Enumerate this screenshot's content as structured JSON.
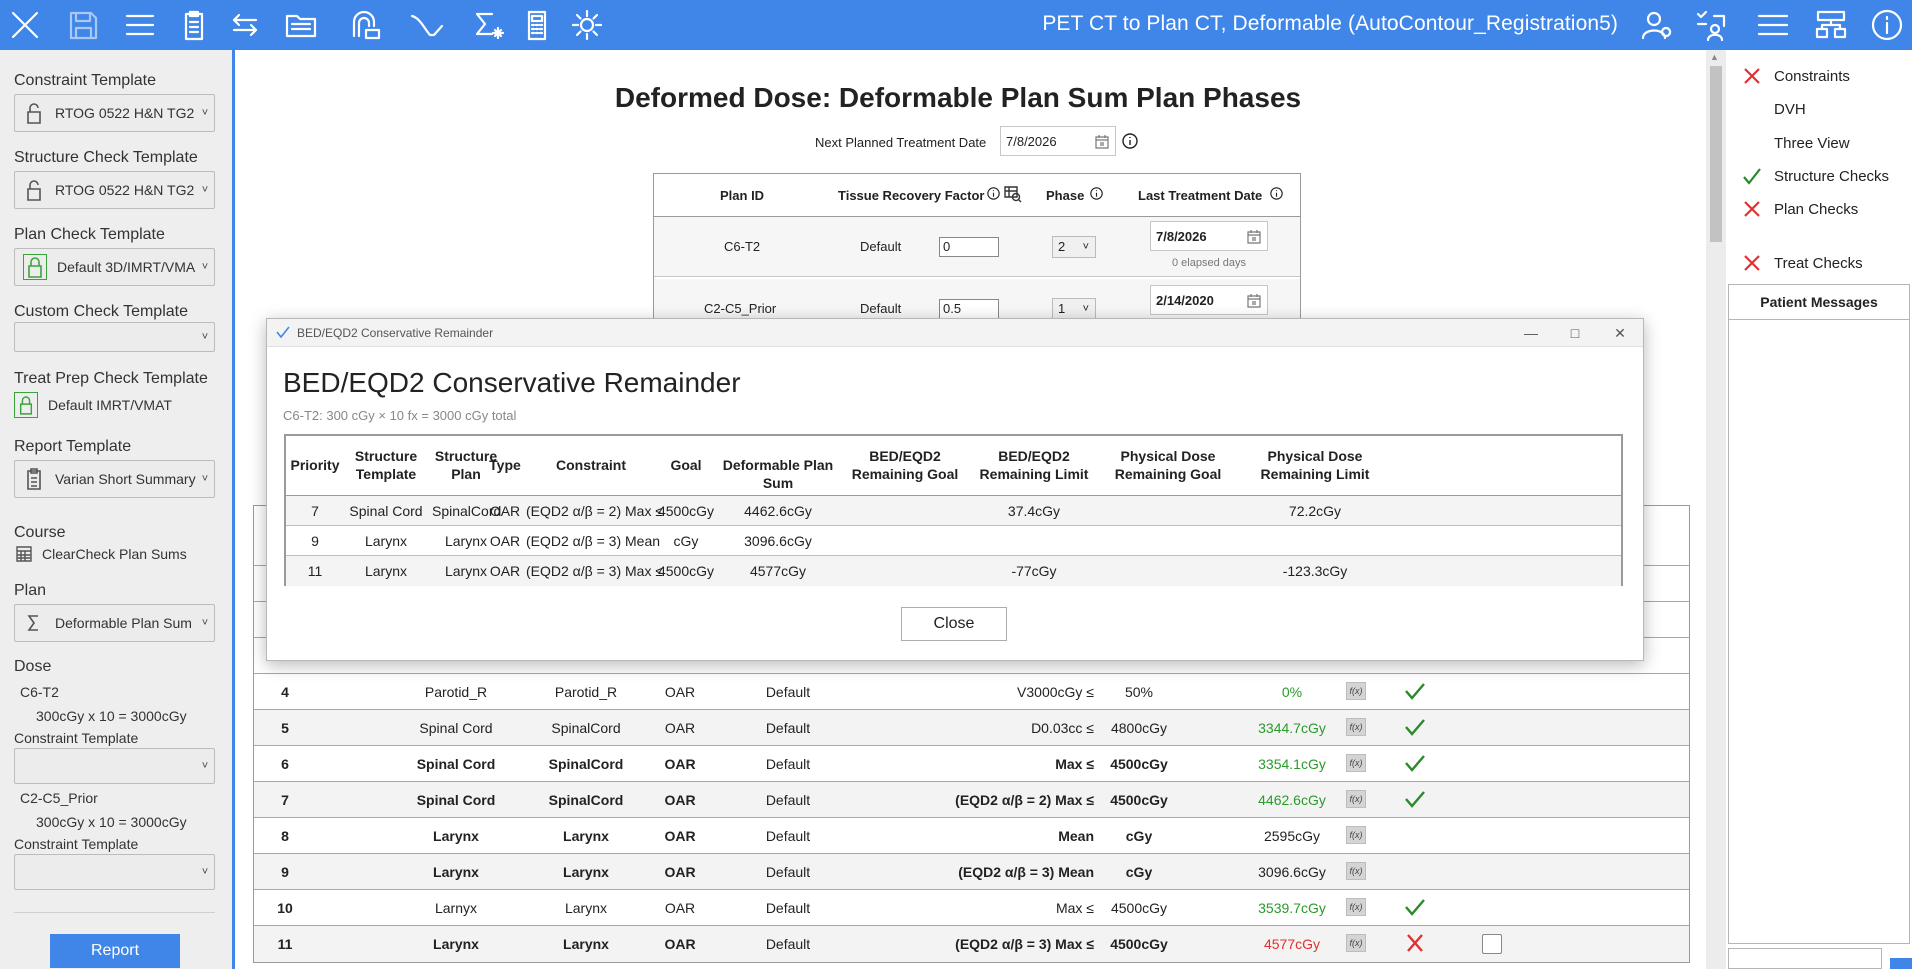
{
  "toolbar": {
    "title": "PET CT to Plan CT, Deformable (AutoContour_Registration5)",
    "left_icons": [
      "close-icon",
      "save-icon",
      "menu-icon",
      "clipboard-icon",
      "swap-icon",
      "folder-icon",
      "registration-icon",
      "dose-curve-icon",
      "sigma-plan-sum-icon",
      "calculator-icon",
      "settings-gear-icon"
    ],
    "right_icons": [
      "user-settings-icon",
      "checklist-user-icon",
      "hamburger-menu-icon",
      "hierarchy-icon",
      "info-icon"
    ]
  },
  "left_panel": {
    "constraint_template_label": "Constraint Template",
    "constraint_template_value": "RTOG 0522 H&N TG2",
    "structure_check_label": "Structure Check Template",
    "structure_check_value": "RTOG 0522 H&N TG2",
    "plan_check_label": "Plan Check Template",
    "plan_check_value": "Default 3D/IMRT/VMA",
    "custom_check_label": "Custom Check Template",
    "custom_check_value": "",
    "treat_prep_label": "Treat Prep Check Template",
    "treat_prep_value": "Default IMRT/VMAT",
    "report_template_label": "Report Template",
    "report_template_value": "Varian Short Summary",
    "course_label": "Course",
    "course_value": "ClearCheck Plan Sums",
    "plan_label": "Plan",
    "plan_value": "Deformable Plan Sum",
    "dose_label": "Dose",
    "dose1_name": "C6-T2",
    "dose1_detail": "300cGy x 10 = 3000cGy",
    "dose1_constraint_label": "Constraint Template",
    "dose2_name": "C2-C5_Prior",
    "dose2_detail": "300cGy x 10 = 3000cGy",
    "dose2_constraint_label": "Constraint Template",
    "report_button": "Report"
  },
  "main": {
    "title": "Deformed Dose:  Deformable Plan Sum Plan Phases",
    "next_date_label": "Next Planned Treatment Date",
    "next_date_value": "7/8/2026",
    "plan_table": {
      "headers": {
        "plan_id": "Plan ID",
        "tissue": "Tissue Recovery Factor",
        "phase": "Phase",
        "last_date": "Last Treatment Date"
      },
      "rows": [
        {
          "plan_id": "C6-T2",
          "tissue": "Default",
          "factor": "0",
          "phase": "2",
          "date": "7/8/2026",
          "elapsed": "0 elapsed days"
        },
        {
          "plan_id": "C2-C5_Prior",
          "tissue": "Default",
          "factor": "0.5",
          "phase": "1",
          "date": "2/14/2020",
          "elapsed": ""
        }
      ]
    },
    "constraint_rows": [
      {
        "num": "4",
        "template": "Parotid_R",
        "plan": "Parotid_R",
        "type": "OAR",
        "trf": "Default",
        "constraint": "V3000cGy ≤",
        "goal": "50%",
        "value": "0%",
        "value_color": "#2a9a2a",
        "status": "check",
        "bold": false
      },
      {
        "num": "5",
        "template": "Spinal Cord",
        "plan": "SpinalCord",
        "type": "OAR",
        "trf": "Default",
        "constraint": "D0.03cc ≤",
        "goal": "4800cGy",
        "value": "3344.7cGy",
        "value_color": "#2a9a2a",
        "status": "check",
        "bold": false
      },
      {
        "num": "6",
        "template": "Spinal Cord",
        "plan": "SpinalCord",
        "type": "OAR",
        "trf": "Default",
        "constraint": "Max ≤",
        "goal": "4500cGy",
        "value": "3354.1cGy",
        "value_color": "#2a9a2a",
        "status": "check",
        "bold": true
      },
      {
        "num": "7",
        "template": "Spinal Cord",
        "plan": "SpinalCord",
        "type": "OAR",
        "trf": "Default",
        "constraint": "(EQD2 α/β = 2) Max ≤",
        "goal": "4500cGy",
        "value": "4462.6cGy",
        "value_color": "#2a9a2a",
        "status": "check",
        "bold": true
      },
      {
        "num": "8",
        "template": "Larynx",
        "plan": "Larynx",
        "type": "OAR",
        "trf": "Default",
        "constraint": "Mean",
        "goal": "cGy",
        "value": "2595cGy",
        "value_color": "#222222",
        "status": "none",
        "bold": true
      },
      {
        "num": "9",
        "template": "Larynx",
        "plan": "Larynx",
        "type": "OAR",
        "trf": "Default",
        "constraint": "(EQD2 α/β = 3) Mean",
        "goal": "cGy",
        "value": "3096.6cGy",
        "value_color": "#222222",
        "status": "none",
        "bold": true
      },
      {
        "num": "10",
        "template": "Larnyx",
        "plan": "Larynx",
        "type": "OAR",
        "trf": "Default",
        "constraint": "Max ≤",
        "goal": "4500cGy",
        "value": "3539.7cGy",
        "value_color": "#2a9a2a",
        "status": "check",
        "bold": false
      },
      {
        "num": "11",
        "template": "Larynx",
        "plan": "Larynx",
        "type": "OAR",
        "trf": "Default",
        "constraint": "(EQD2 α/β = 3) Max ≤",
        "goal": "4500cGy",
        "value": "4577cGy",
        "value_color": "#e03030",
        "status": "x",
        "bold": true
      }
    ],
    "fx_label": "f(x)"
  },
  "right_panel": {
    "items": [
      {
        "label": "Constraints",
        "mark": "x"
      },
      {
        "label": "DVH",
        "mark": "none"
      },
      {
        "label": "Three View",
        "mark": "none"
      },
      {
        "label": "Structure Checks",
        "mark": "check"
      },
      {
        "label": "Plan Checks",
        "mark": "x"
      },
      {
        "label": "Treat Checks",
        "mark": "x"
      }
    ],
    "patient_messages": "Patient Messages"
  },
  "dialog": {
    "window_title": "BED/EQD2 Conservative Remainder",
    "title": "BED/EQD2 Conservative Remainder",
    "subtitle": "C6-T2: 300 cGy × 10 fx = 3000 cGy total",
    "headers": {
      "priority": "Priority",
      "structure_template": "Structure Template",
      "structure_plan": "Structure Plan",
      "type": "Type",
      "constraint": "Constraint",
      "goal": "Goal",
      "deformable": "Deformable Plan Sum",
      "bed_goal": "BED/EQD2 Remaining Goal",
      "bed_limit": "BED/EQD2 Remaining Limit",
      "phys_goal": "Physical Dose Remaining Goal",
      "phys_limit": "Physical Dose Remaining Limit"
    },
    "rows": [
      {
        "priority": "7",
        "template": "Spinal Cord",
        "plan": "SpinalCord",
        "type": "OAR",
        "constraint": "(EQD2 α/β = 2) Max ≤",
        "goal": "4500cGy",
        "deformable": "4462.6cGy",
        "bed_goal": "",
        "bed_limit": "37.4cGy",
        "phys_goal": "",
        "phys_limit": "72.2cGy"
      },
      {
        "priority": "9",
        "template": "Larynx",
        "plan": "Larynx",
        "type": "OAR",
        "constraint": "(EQD2 α/β = 3) Mean",
        "goal": "cGy",
        "deformable": "3096.6cGy",
        "bed_goal": "",
        "bed_limit": "",
        "phys_goal": "",
        "phys_limit": ""
      },
      {
        "priority": "11",
        "template": "Larynx",
        "plan": "Larynx",
        "type": "OAR",
        "constraint": "(EQD2 α/β = 3) Max ≤",
        "goal": "4500cGy",
        "deformable": "4577cGy",
        "bed_goal": "",
        "bed_limit": "-77cGy",
        "phys_goal": "",
        "phys_limit": "-123.3cGy"
      }
    ],
    "close_button": "Close"
  }
}
